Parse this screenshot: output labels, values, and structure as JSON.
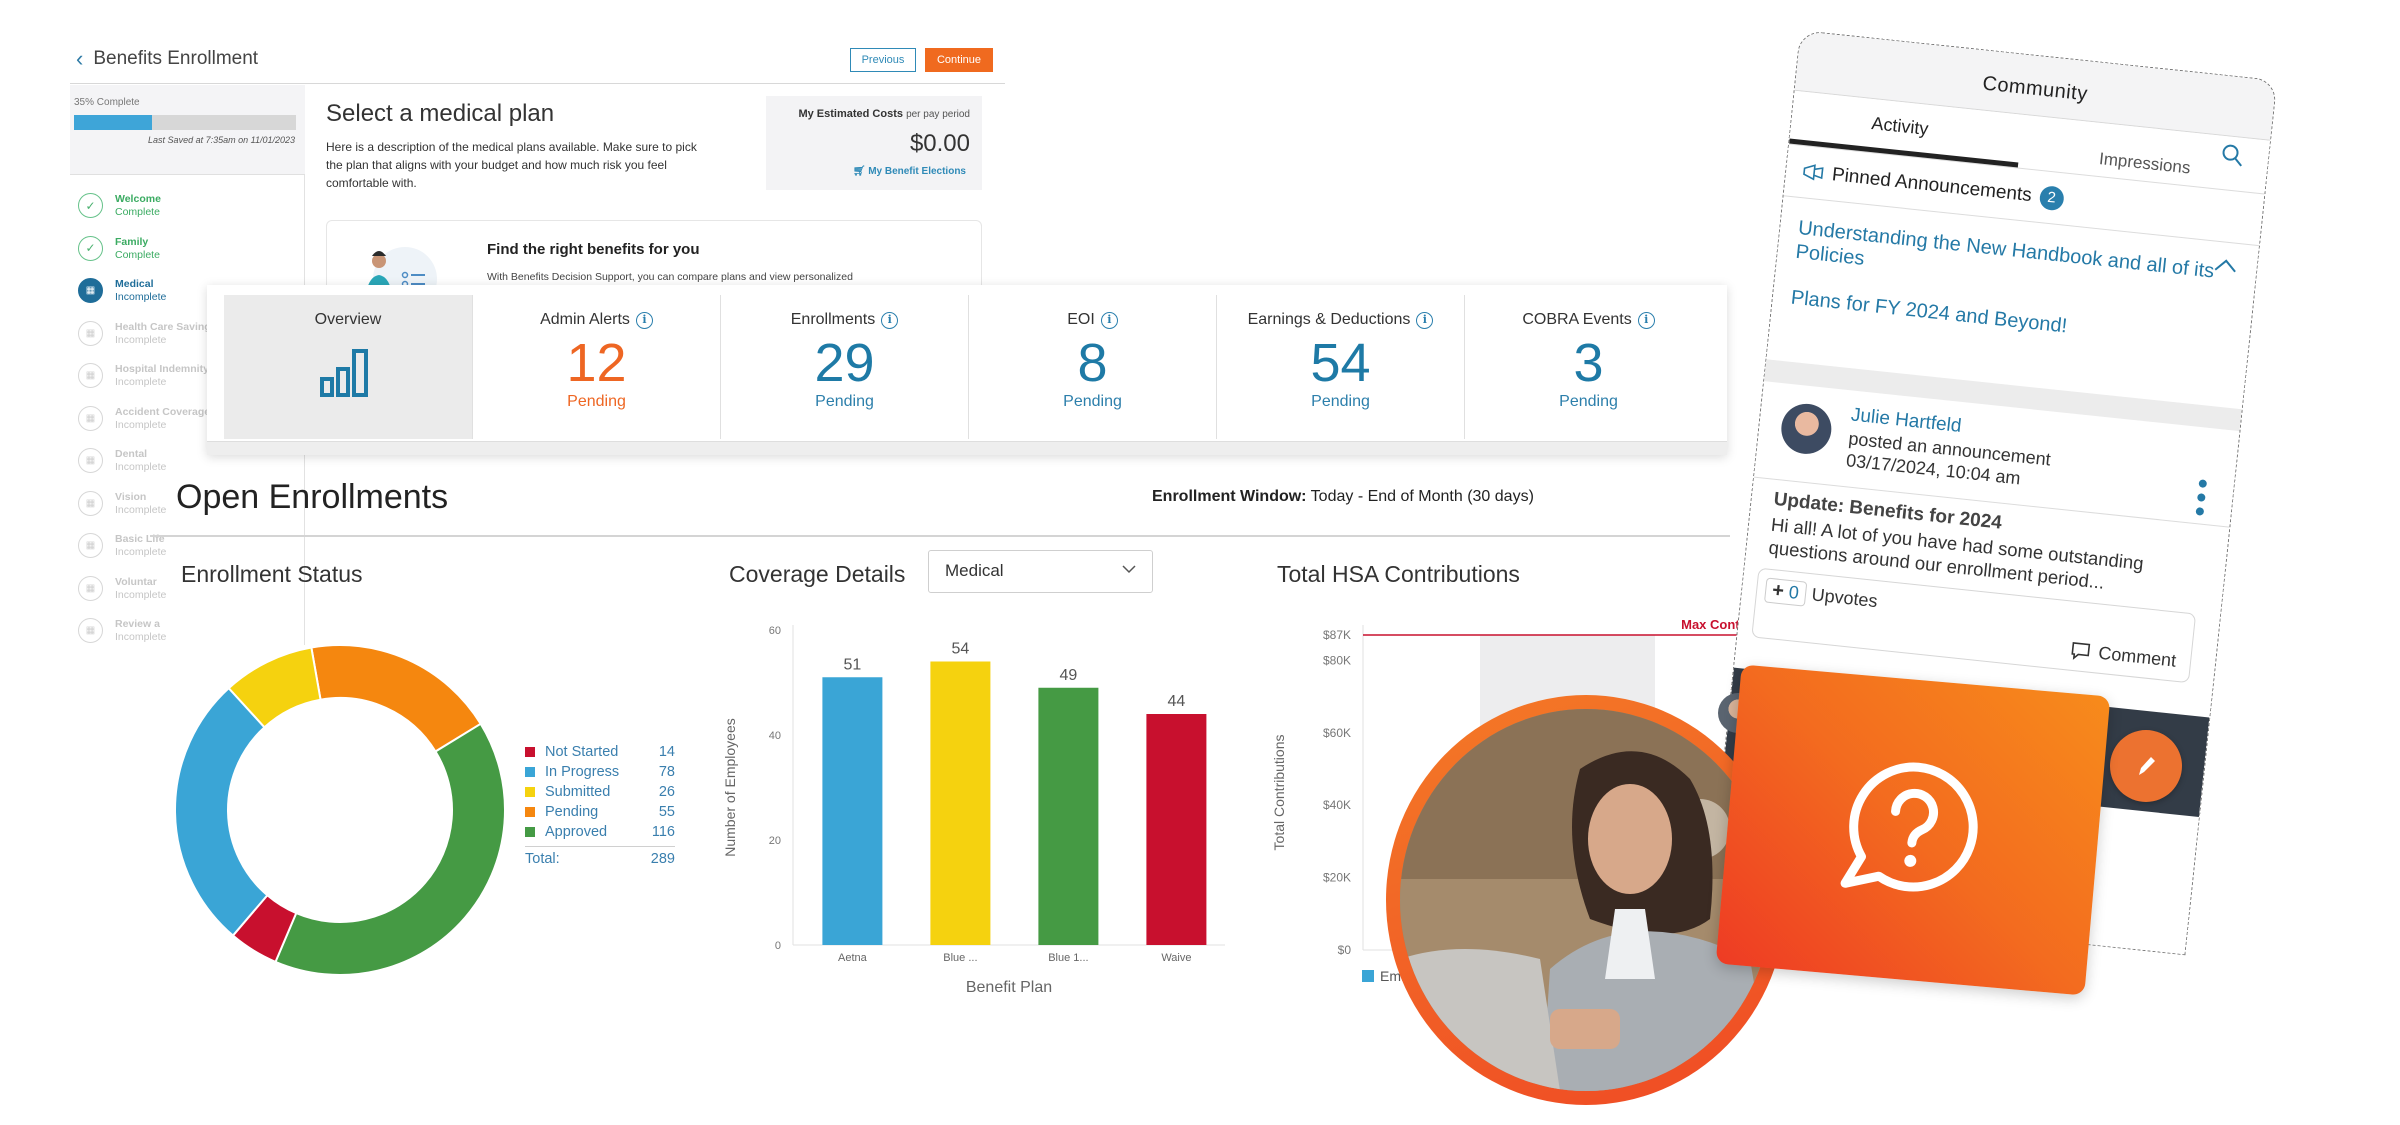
{
  "enrollment": {
    "back_label": "Benefits Enrollment",
    "previous_label": "Previous",
    "continue_label": "Continue",
    "progress_label": "35% Complete",
    "progress_percent": 35,
    "last_saved": "Last Saved at 7:35am on 11/01/2023",
    "steps": [
      {
        "name": "Welcome",
        "status": "Complete",
        "state": "done"
      },
      {
        "name": "Family",
        "status": "Complete",
        "state": "done"
      },
      {
        "name": "Medical",
        "status": "Incomplete",
        "state": "current"
      },
      {
        "name": "Health Care Saving",
        "status": "Incomplete",
        "state": "todo"
      },
      {
        "name": "Hospital Indemnity",
        "status": "Incomplete",
        "state": "todo"
      },
      {
        "name": "Accident Coverage",
        "status": "Incomplete",
        "state": "todo"
      },
      {
        "name": "Dental",
        "status": "Incomplete",
        "state": "todo"
      },
      {
        "name": "Vision",
        "status": "Incomplete",
        "state": "todo"
      },
      {
        "name": "Basic Life",
        "status": "Incomplete",
        "state": "todo"
      },
      {
        "name": "Voluntar",
        "status": "Incomplete",
        "state": "todo"
      },
      {
        "name": "Review a",
        "status": "Incomplete",
        "state": "todo"
      }
    ],
    "title": "Select a medical plan",
    "description": "Here is a description of the medical plans available. Make sure to pick the plan that aligns with your budget and how much risk you feel comfortable with.",
    "cost_label": "My Estimated Costs",
    "cost_period": "per pay period",
    "cost_amount": "$0.00",
    "elections_link": "My Benefit Elections",
    "find_title": "Find the right benefits for you",
    "find_desc": "With Benefits Decision Support, you can compare plans and view personalized recommendations."
  },
  "stats": {
    "tiles": [
      {
        "label": "Overview",
        "icon": "bar-chart-icon"
      },
      {
        "label": "Admin Alerts",
        "value": "12",
        "sub": "Pending"
      },
      {
        "label": "Enrollments",
        "value": "29",
        "sub": "Pending"
      },
      {
        "label": "EOI",
        "value": "8",
        "sub": "Pending"
      },
      {
        "label": "Earnings & Deductions",
        "value": "54",
        "sub": "Pending"
      },
      {
        "label": "COBRA Events",
        "value": "3",
        "sub": "Pending"
      }
    ]
  },
  "open_enrollments": {
    "title": "Open Enrollments",
    "window_label": "Enrollment Window:",
    "window_value": "Today - End of Month (30 days)",
    "status_title": "Enrollment Status",
    "coverage_title": "Coverage Details",
    "coverage_select": "Medical",
    "hsa_title": "Total HSA Contributions",
    "legend_total_label": "Total:",
    "legend_total_value": "289"
  },
  "chart_data": [
    {
      "type": "pie",
      "title": "Enrollment Status",
      "donut": true,
      "categories": [
        "Not Started",
        "In Progress",
        "Submitted",
        "Pending",
        "Approved"
      ],
      "values": [
        14,
        78,
        26,
        55,
        116
      ],
      "colors": [
        "#c8102e",
        "#3aa5d6",
        "#f5d20f",
        "#f5870f",
        "#459a44"
      ],
      "total": 289,
      "legend": "right"
    },
    {
      "type": "bar",
      "title": "Coverage Details",
      "categories": [
        "Aetna",
        "Blue ...",
        "Blue 1...",
        "Waive"
      ],
      "values": [
        51,
        54,
        49,
        44
      ],
      "colors": [
        "#3aa5d6",
        "#f5d20f",
        "#459a44",
        "#c8102e"
      ],
      "xlabel": "Benefit Plan",
      "ylabel": "Number of Employees",
      "ylim": [
        0,
        60
      ],
      "yticks": [
        0,
        20,
        40,
        60
      ]
    },
    {
      "type": "bar",
      "title": "Total HSA Contributions",
      "ylabel": "Total Contributions",
      "yticks": [
        "$0",
        "$20K",
        "$40K",
        "$60K",
        "$80K",
        "$87K"
      ],
      "ylim": [
        0,
        87000
      ],
      "reference_line": {
        "label": "Max Contribution",
        "value": 87000,
        "color": "#c8102e"
      },
      "legend": [
        "Em..."
      ],
      "legend_color": "#3aa5d6"
    }
  ],
  "community": {
    "title": "Community",
    "tabs": [
      "Activity",
      "Impressions"
    ],
    "active_tab": "Activity",
    "pinned_label": "Pinned Announcements",
    "pinned_count": "2",
    "announcements": [
      "Understanding the New Handbook and all of its Policies",
      "Plans for FY 2024 and Beyond!"
    ],
    "post": {
      "author": "Julie Hartfeld",
      "action": "posted an announcement",
      "timestamp": "03/17/2024, 10:04 am",
      "subject": "Update: Benefits for 2024",
      "body": "Hi all! A lot of you have had some outstanding questions around our enrollment period...",
      "upvote_count": "0",
      "upvotes_label": "Upvotes",
      "comment_label": "Comment"
    }
  },
  "colors": {
    "accent_orange": "#f06a1f",
    "accent_blue": "#1e7aa6"
  }
}
